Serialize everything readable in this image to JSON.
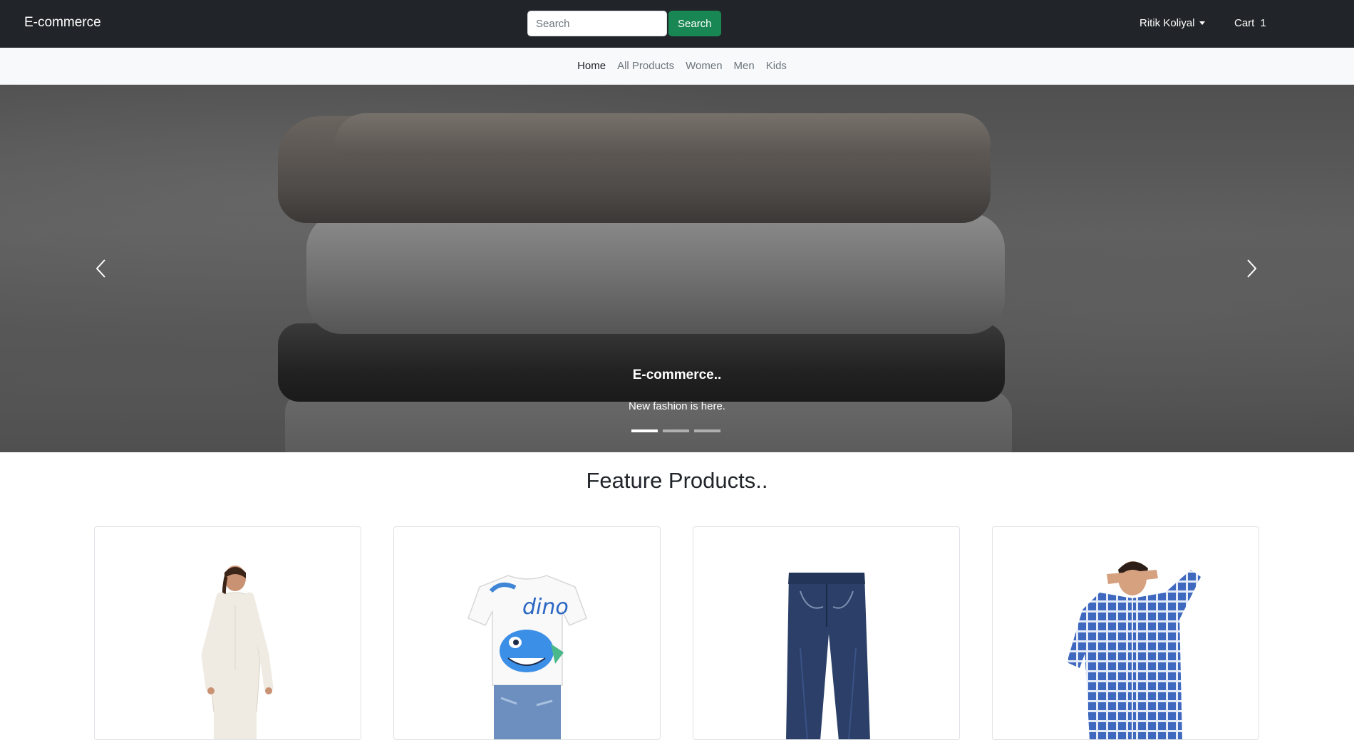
{
  "navbar": {
    "brand": "E-commerce",
    "search_placeholder": "Search",
    "search_button": "Search",
    "user_name": "Ritik Koliyal",
    "cart_label": "Cart",
    "cart_count": "1"
  },
  "subnav": {
    "items": [
      {
        "label": "Home",
        "active": true
      },
      {
        "label": "All Products",
        "active": false
      },
      {
        "label": "Women",
        "active": false
      },
      {
        "label": "Men",
        "active": false
      },
      {
        "label": "Kids",
        "active": false
      }
    ]
  },
  "carousel": {
    "caption_title": "E-commerce..",
    "caption_text": "New fashion is here.",
    "slide_count": 3,
    "active_slide": 1
  },
  "feature": {
    "title": "Feature Products.."
  },
  "icons": {
    "prev": "chevron-left-icon",
    "next": "chevron-right-icon",
    "user_caret": "caret-down-icon"
  },
  "colors": {
    "navbar_bg": "#212529",
    "search_button_bg": "#198754",
    "subnav_bg": "#f8f9fa"
  }
}
